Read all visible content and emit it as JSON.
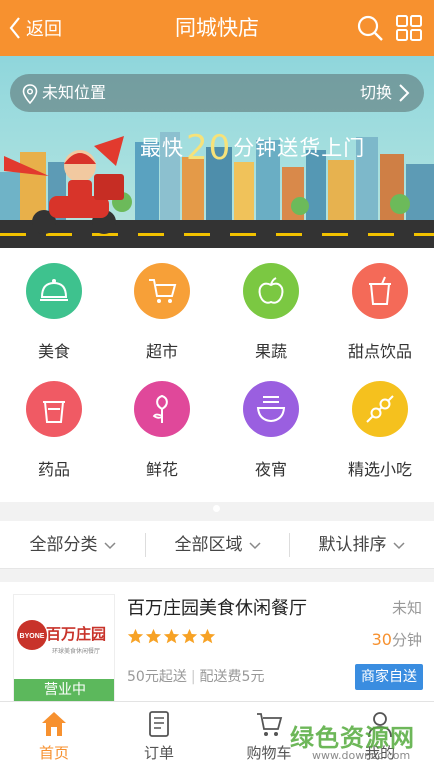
{
  "header": {
    "back_label": "返回",
    "title": "同城快店",
    "icons": [
      "search-icon",
      "grid-menu-icon"
    ],
    "color": "#f7912f"
  },
  "banner": {
    "location": "未知位置",
    "switch_label": "切换",
    "slogan_prefix": "最快",
    "slogan_number": "20",
    "slogan_suffix": "分钟送货上门"
  },
  "categories": [
    {
      "label": "美食",
      "icon": "food-cloche-icon",
      "color": "#3ec28e"
    },
    {
      "label": "超市",
      "icon": "shopping-cart-icon",
      "color": "#f7a038"
    },
    {
      "label": "果蔬",
      "icon": "apple-icon",
      "color": "#7bc842"
    },
    {
      "label": "甜点饮品",
      "icon": "drink-cup-icon",
      "color": "#f46a58"
    },
    {
      "label": "药品",
      "icon": "medicine-cup-icon",
      "color": "#f05a64"
    },
    {
      "label": "鲜花",
      "icon": "rose-icon",
      "color": "#e0489a"
    },
    {
      "label": "夜宵",
      "icon": "noodle-bowl-icon",
      "color": "#9a5fe0"
    },
    {
      "label": "精选小吃",
      "icon": "skewer-icon",
      "color": "#f5c11e"
    }
  ],
  "filters": {
    "category": "全部分类",
    "area": "全部区域",
    "sort": "默认排序"
  },
  "shop": {
    "name": "百万庄园美食休闲餐厅",
    "distance": "未知",
    "time_value": "30",
    "time_unit": "分钟",
    "min_order": "50元起送",
    "delivery_fee": "配送费5元",
    "delivery_tag": "商家自送",
    "status": "营业中",
    "rating_stars": 5,
    "logo_brand": "BYONE",
    "logo_name": "百万庄园",
    "logo_sub": "环球美食休闲餐厅"
  },
  "tabbar": {
    "items": [
      {
        "label": "首页",
        "icon": "home-icon",
        "active": true
      },
      {
        "label": "订单",
        "icon": "order-list-icon",
        "active": false
      },
      {
        "label": "购物车",
        "icon": "cart-icon",
        "active": false
      },
      {
        "label": "我的",
        "icon": "user-icon",
        "active": false
      }
    ]
  },
  "watermark": {
    "title": "绿色资源网",
    "url": "www.downcc.com"
  }
}
